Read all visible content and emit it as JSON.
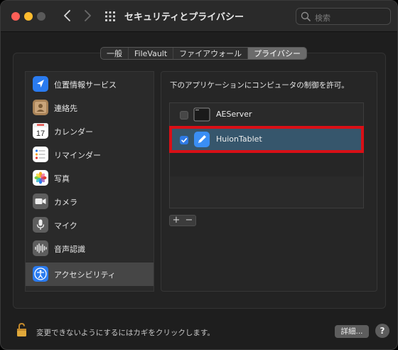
{
  "window": {
    "title": "セキュリティとプライバシー",
    "search_placeholder": "検索"
  },
  "tabs": [
    {
      "label": "一般",
      "active": false
    },
    {
      "label": "FileVault",
      "active": false
    },
    {
      "label": "ファイアウォール",
      "active": false
    },
    {
      "label": "プライバシー",
      "active": true
    }
  ],
  "sidebar": {
    "items": [
      {
        "label": "位置情報サービス",
        "icon": "location-arrow-icon",
        "color": "#2a7bf0"
      },
      {
        "label": "連絡先",
        "icon": "contacts-icon",
        "color": "#b08a5c"
      },
      {
        "label": "カレンダー",
        "icon": "calendar-icon",
        "color": "#ffffff",
        "day": "17"
      },
      {
        "label": "リマインダー",
        "icon": "reminders-icon",
        "color": "#ffffff"
      },
      {
        "label": "写真",
        "icon": "photos-icon",
        "color": "#ffffff"
      },
      {
        "label": "カメラ",
        "icon": "camera-icon",
        "color": "#6a6a6a"
      },
      {
        "label": "マイク",
        "icon": "microphone-icon",
        "color": "#6a6a6a"
      },
      {
        "label": "音声認識",
        "icon": "speech-recognition-icon",
        "color": "#6a6a6a"
      },
      {
        "label": "アクセシビリティ",
        "icon": "accessibility-icon",
        "color": "#2a7bf0",
        "selected": true
      }
    ]
  },
  "content": {
    "description": "下のアプリケーションにコンピュータの制御を許可。",
    "apps": [
      {
        "name": "AEServer",
        "checked": false,
        "icon": "terminal-icon"
      },
      {
        "name": "HuionTablet",
        "checked": true,
        "icon": "pen-app-icon",
        "selected": true
      }
    ],
    "add_label": "+",
    "remove_label": "−"
  },
  "footer": {
    "lock_text": "変更できないようにするにはカギをクリックします。",
    "advanced_label": "詳細...",
    "help_label": "?"
  },
  "colors": {
    "selection_blue": "#36566c",
    "highlight_red": "#d90f16",
    "check_blue": "#2f7ae5"
  }
}
